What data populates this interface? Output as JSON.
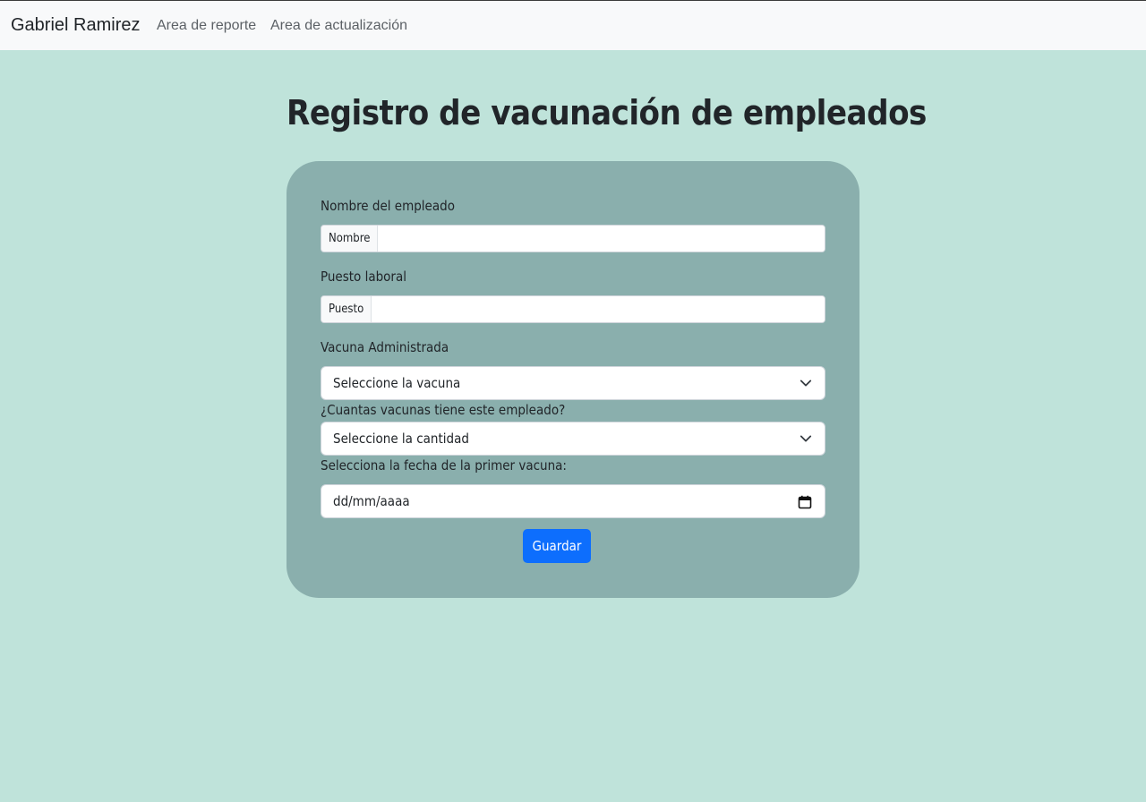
{
  "navbar": {
    "brand": "Gabriel Ramirez",
    "links": [
      "Area de reporte",
      "Area de actualización"
    ]
  },
  "page": {
    "title": "Registro de vacunación de empleados"
  },
  "form": {
    "nombre": {
      "label": "Nombre del empleado",
      "addon": "Nombre",
      "value": ""
    },
    "puesto": {
      "label": "Puesto laboral",
      "addon": "Puesto",
      "value": ""
    },
    "vacuna": {
      "label": "Vacuna Administrada",
      "selected": "Seleccione la vacuna"
    },
    "cantidad": {
      "label": "¿Cuantas vacunas tiene este empleado?",
      "selected": "Seleccione la cantidad"
    },
    "fecha": {
      "label": "Selecciona la fecha de la primer vacuna:",
      "placeholder": "dd/mm/aaaa"
    },
    "submit_label": "Guardar"
  },
  "colors": {
    "page_background": "#bfe3da",
    "card_background": "#8aafad",
    "navbar_background": "#f8f9fa",
    "primary_button": "#0d6efd"
  },
  "icons": {
    "select_arrow": "chevron-down-icon",
    "date_picker": "calendar-icon"
  }
}
